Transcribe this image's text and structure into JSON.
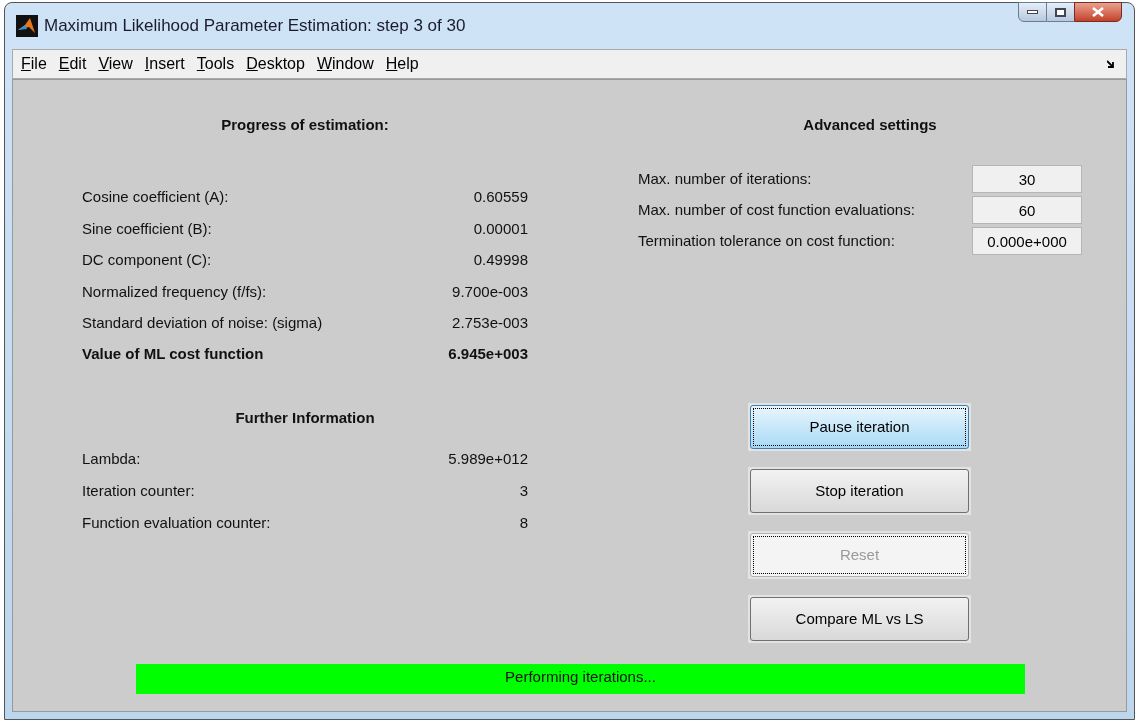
{
  "window": {
    "title": "Maximum Likelihood Parameter Estimation: step 3 of 30"
  },
  "menu": [
    "File",
    "Edit",
    "View",
    "Insert",
    "Tools",
    "Desktop",
    "Window",
    "Help"
  ],
  "progress": {
    "heading": "Progress of estimation:",
    "rows": [
      {
        "label": "Cosine coefficient (A):",
        "value": "0.60559",
        "emphasized": false
      },
      {
        "label": "Sine coefficient (B):",
        "value": "0.00001",
        "emphasized": false
      },
      {
        "label": "DC component (C):",
        "value": "0.49998",
        "emphasized": false
      },
      {
        "label": "Normalized frequency (f/fs):",
        "value": "9.700e-003",
        "emphasized": false
      },
      {
        "label": "Standard deviation of noise: (sigma)",
        "value": "2.753e-003",
        "emphasized": false
      },
      {
        "label": "Value of ML cost function",
        "value": "6.945e+003",
        "emphasized": true
      }
    ]
  },
  "further": {
    "heading": "Further Information",
    "rows": [
      {
        "label": "Lambda:",
        "value": "5.989e+012"
      },
      {
        "label": "Iteration counter:",
        "value": "3"
      },
      {
        "label": "Function evaluation counter:",
        "value": "8"
      }
    ]
  },
  "advanced": {
    "heading": "Advanced settings",
    "fields": [
      {
        "label": "Max. number of iterations:",
        "value": "30"
      },
      {
        "label": "Max. number of cost function evaluations:",
        "value": "60"
      },
      {
        "label": "Termination tolerance on cost function:",
        "value": "0.000e+000"
      }
    ]
  },
  "buttons": [
    {
      "label": "Pause iteration",
      "highlighted": true,
      "focused": true,
      "disabled": false
    },
    {
      "label": "Stop iteration",
      "highlighted": false,
      "focused": false,
      "disabled": false
    },
    {
      "label": "Reset",
      "highlighted": false,
      "focused": true,
      "disabled": true
    },
    {
      "label": "Compare ML vs LS",
      "highlighted": false,
      "focused": false,
      "disabled": false
    }
  ],
  "status_bar": {
    "text": "Performing iterations..."
  }
}
